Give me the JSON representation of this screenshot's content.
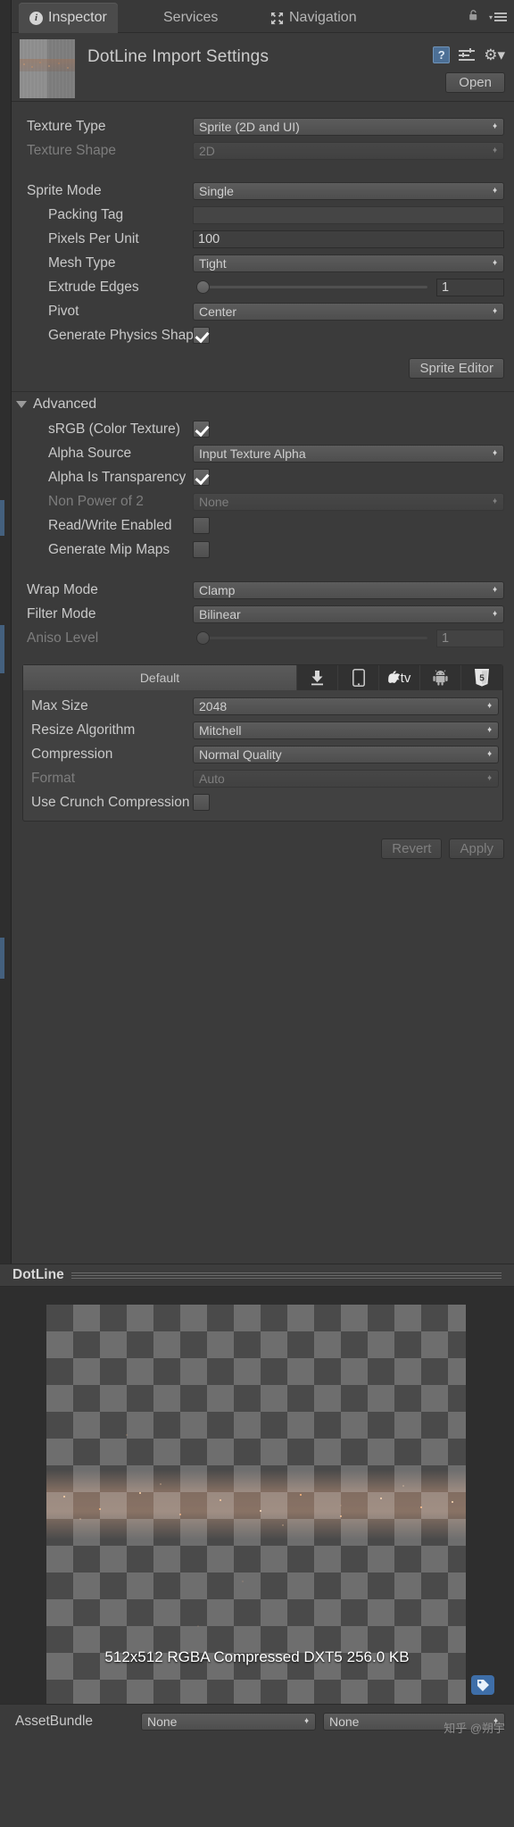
{
  "window": {
    "tabs": [
      {
        "label": "Inspector",
        "icon": "info-icon",
        "active": true
      },
      {
        "label": "Services",
        "icon": "",
        "active": false
      },
      {
        "label": "Navigation",
        "icon": "navigation-icon",
        "active": false
      }
    ],
    "lock_icon": "lock-icon",
    "menu_icon": "hamburger-menu-icon"
  },
  "header": {
    "title": "DotLine Import Settings",
    "help_icon": "help-icon",
    "preset_icon": "preset-icon",
    "gear_icon": "gear-icon",
    "open_label": "Open"
  },
  "texture": {
    "type_label": "Texture Type",
    "type_value": "Sprite (2D and UI)",
    "shape_label": "Texture Shape",
    "shape_value": "2D"
  },
  "sprite": {
    "mode_label": "Sprite Mode",
    "mode_value": "Single",
    "packing_tag_label": "Packing Tag",
    "packing_tag_value": "",
    "pixels_per_unit_label": "Pixels Per Unit",
    "pixels_per_unit_value": "100",
    "mesh_type_label": "Mesh Type",
    "mesh_type_value": "Tight",
    "extrude_label": "Extrude Edges",
    "extrude_value": "1",
    "pivot_label": "Pivot",
    "pivot_value": "Center",
    "physics_label": "Generate Physics Shape",
    "sprite_editor_label": "Sprite Editor"
  },
  "advanced": {
    "title": "Advanced",
    "srgb_label": "sRGB (Color Texture)",
    "alpha_source_label": "Alpha Source",
    "alpha_source_value": "Input Texture Alpha",
    "alpha_transparent_label": "Alpha Is Transparency",
    "npot_label": "Non Power of 2",
    "npot_value": "None",
    "read_write_label": "Read/Write Enabled",
    "mipmaps_label": "Generate Mip Maps"
  },
  "sampling": {
    "wrap_label": "Wrap Mode",
    "wrap_value": "Clamp",
    "filter_label": "Filter Mode",
    "filter_value": "Bilinear",
    "aniso_label": "Aniso Level",
    "aniso_value": "1"
  },
  "platforms": {
    "tabs": [
      {
        "label": "Default",
        "icon": "",
        "active": true
      },
      {
        "label": "",
        "icon": "standalone-download-icon",
        "active": false
      },
      {
        "label": "",
        "icon": "ios-phone-icon",
        "active": false
      },
      {
        "label": "tv",
        "icon": "apple-tv-icon",
        "active": false
      },
      {
        "label": "",
        "icon": "android-robot-icon",
        "active": false
      },
      {
        "label": "5",
        "icon": "webgl-html5-icon",
        "active": false
      }
    ],
    "max_size_label": "Max Size",
    "max_size_value": "2048",
    "resize_label": "Resize Algorithm",
    "resize_value": "Mitchell",
    "compression_label": "Compression",
    "compression_value": "Normal Quality",
    "format_label": "Format",
    "format_value": "Auto",
    "crunch_label": "Use Crunch Compression"
  },
  "footer": {
    "revert_label": "Revert",
    "apply_label": "Apply"
  },
  "preview": {
    "title": "DotLine",
    "info": "512x512  RGBA Compressed DXT5   256.0 KB",
    "tag_icon": "tag-icon"
  },
  "assetbundle": {
    "label": "AssetBundle",
    "name_value": "None",
    "variant_value": "None"
  },
  "watermark": "知乎 @朔宇",
  "colors": {
    "panel_bg": "#3b3b3b",
    "tab_active": "#4b4b4b",
    "accent_blue": "#4c6f95",
    "tag_blue": "#3e6ea8",
    "text": "#c9c9c9",
    "text_dim": "#7d7d7d"
  }
}
